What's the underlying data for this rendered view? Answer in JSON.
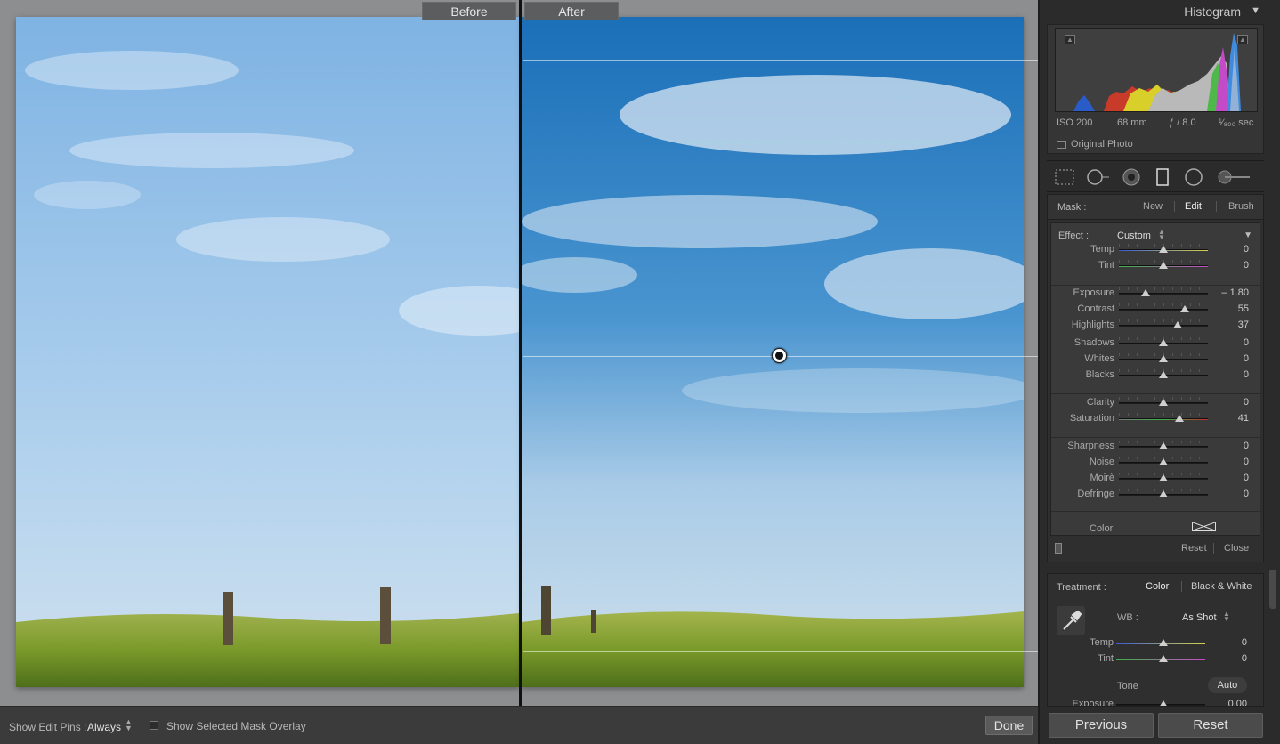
{
  "compare": {
    "before_label": "Before",
    "after_label": "After"
  },
  "toolbar": {
    "pins_label": "Show Edit Pins :",
    "pins_value": "Always",
    "overlay_label": "Show Selected Mask Overlay",
    "done_label": "Done"
  },
  "histogram": {
    "title": "Histogram",
    "iso": "ISO 200",
    "focal": "68 mm",
    "aperture": "ƒ / 8.0",
    "shutter": "¹⁄₈₀₀ sec",
    "original_photo_label": "Original Photo"
  },
  "mask": {
    "label": "Mask :",
    "new": "New",
    "edit": "Edit",
    "brush": "Brush",
    "effect_label": "Effect :",
    "effect_value": "Custom",
    "color_label": "Color",
    "reset": "Reset",
    "close": "Close",
    "sliders": [
      {
        "label": "Temp",
        "value": "0",
        "pos": 0.5
      },
      {
        "label": "Tint",
        "value": "0",
        "pos": 0.5
      },
      {
        "label": "Exposure",
        "value": "– 1.80",
        "pos": 0.3
      },
      {
        "label": "Contrast",
        "value": "55",
        "pos": 0.74
      },
      {
        "label": "Highlights",
        "value": "37",
        "pos": 0.66
      },
      {
        "label": "Shadows",
        "value": "0",
        "pos": 0.5
      },
      {
        "label": "Whites",
        "value": "0",
        "pos": 0.5
      },
      {
        "label": "Blacks",
        "value": "0",
        "pos": 0.5
      },
      {
        "label": "Clarity",
        "value": "0",
        "pos": 0.5
      },
      {
        "label": "Saturation",
        "value": "41",
        "pos": 0.68
      },
      {
        "label": "Sharpness",
        "value": "0",
        "pos": 0.5
      },
      {
        "label": "Noise",
        "value": "0",
        "pos": 0.5
      },
      {
        "label": "Moirè",
        "value": "0",
        "pos": 0.5
      },
      {
        "label": "Defringe",
        "value": "0",
        "pos": 0.5
      }
    ]
  },
  "basic": {
    "treatment_label": "Treatment :",
    "treatment_color": "Color",
    "treatment_bw": "Black & White",
    "wb_label": "WB :",
    "wb_value": "As Shot",
    "temp_label": "Temp",
    "temp_value": "0",
    "tint_label": "Tint",
    "tint_value": "0",
    "tone_label": "Tone",
    "auto_label": "Auto",
    "exposure_label": "Exposure",
    "exposure_value": "0.00"
  },
  "nav": {
    "previous": "Previous",
    "reset": "Reset"
  },
  "icons": {
    "dropper": "eyedropper-icon",
    "collapse": "triangle-down-icon"
  },
  "colors": {
    "sky_before": "#8fbde6",
    "sky_after": "#1f78c2",
    "grass": "#7f9a2e"
  }
}
